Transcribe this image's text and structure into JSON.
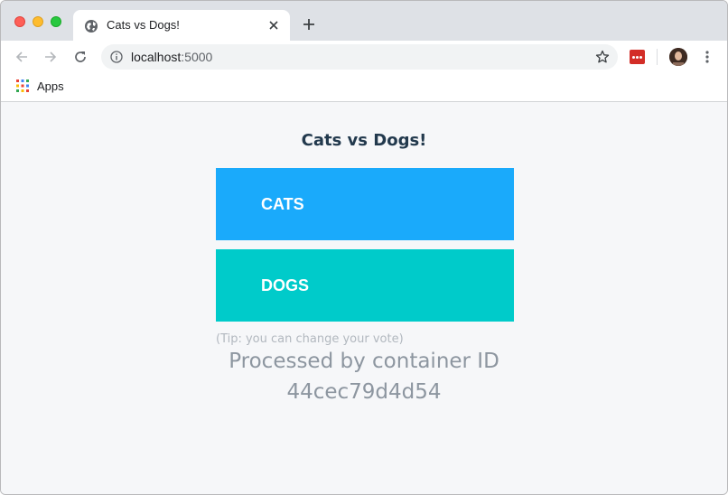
{
  "browser": {
    "tab": {
      "title": "Cats vs Dogs!"
    },
    "address_bar": {
      "host": "localhost",
      "port": ":5000"
    },
    "bookmarks": {
      "apps_label": "Apps"
    },
    "colors": {
      "tabstrip": "#dee1e6",
      "extension_red": "#d32d27"
    }
  },
  "page": {
    "title": "Cats vs Dogs!",
    "options": [
      {
        "label": "CATS",
        "color": "#1aaafb"
      },
      {
        "label": "DOGS",
        "color": "#00cbca"
      }
    ],
    "tip": "(Tip: you can change your vote)",
    "processed_label": "Processed by container ID",
    "container_id": "44cec79d4d54"
  },
  "icons": [
    "globe-icon",
    "close-icon",
    "plus-icon",
    "back-arrow-icon",
    "forward-arrow-icon",
    "reload-icon",
    "info-icon",
    "star-icon",
    "extension-icon",
    "avatar",
    "more-vert-icon",
    "apps-grid-icon"
  ]
}
